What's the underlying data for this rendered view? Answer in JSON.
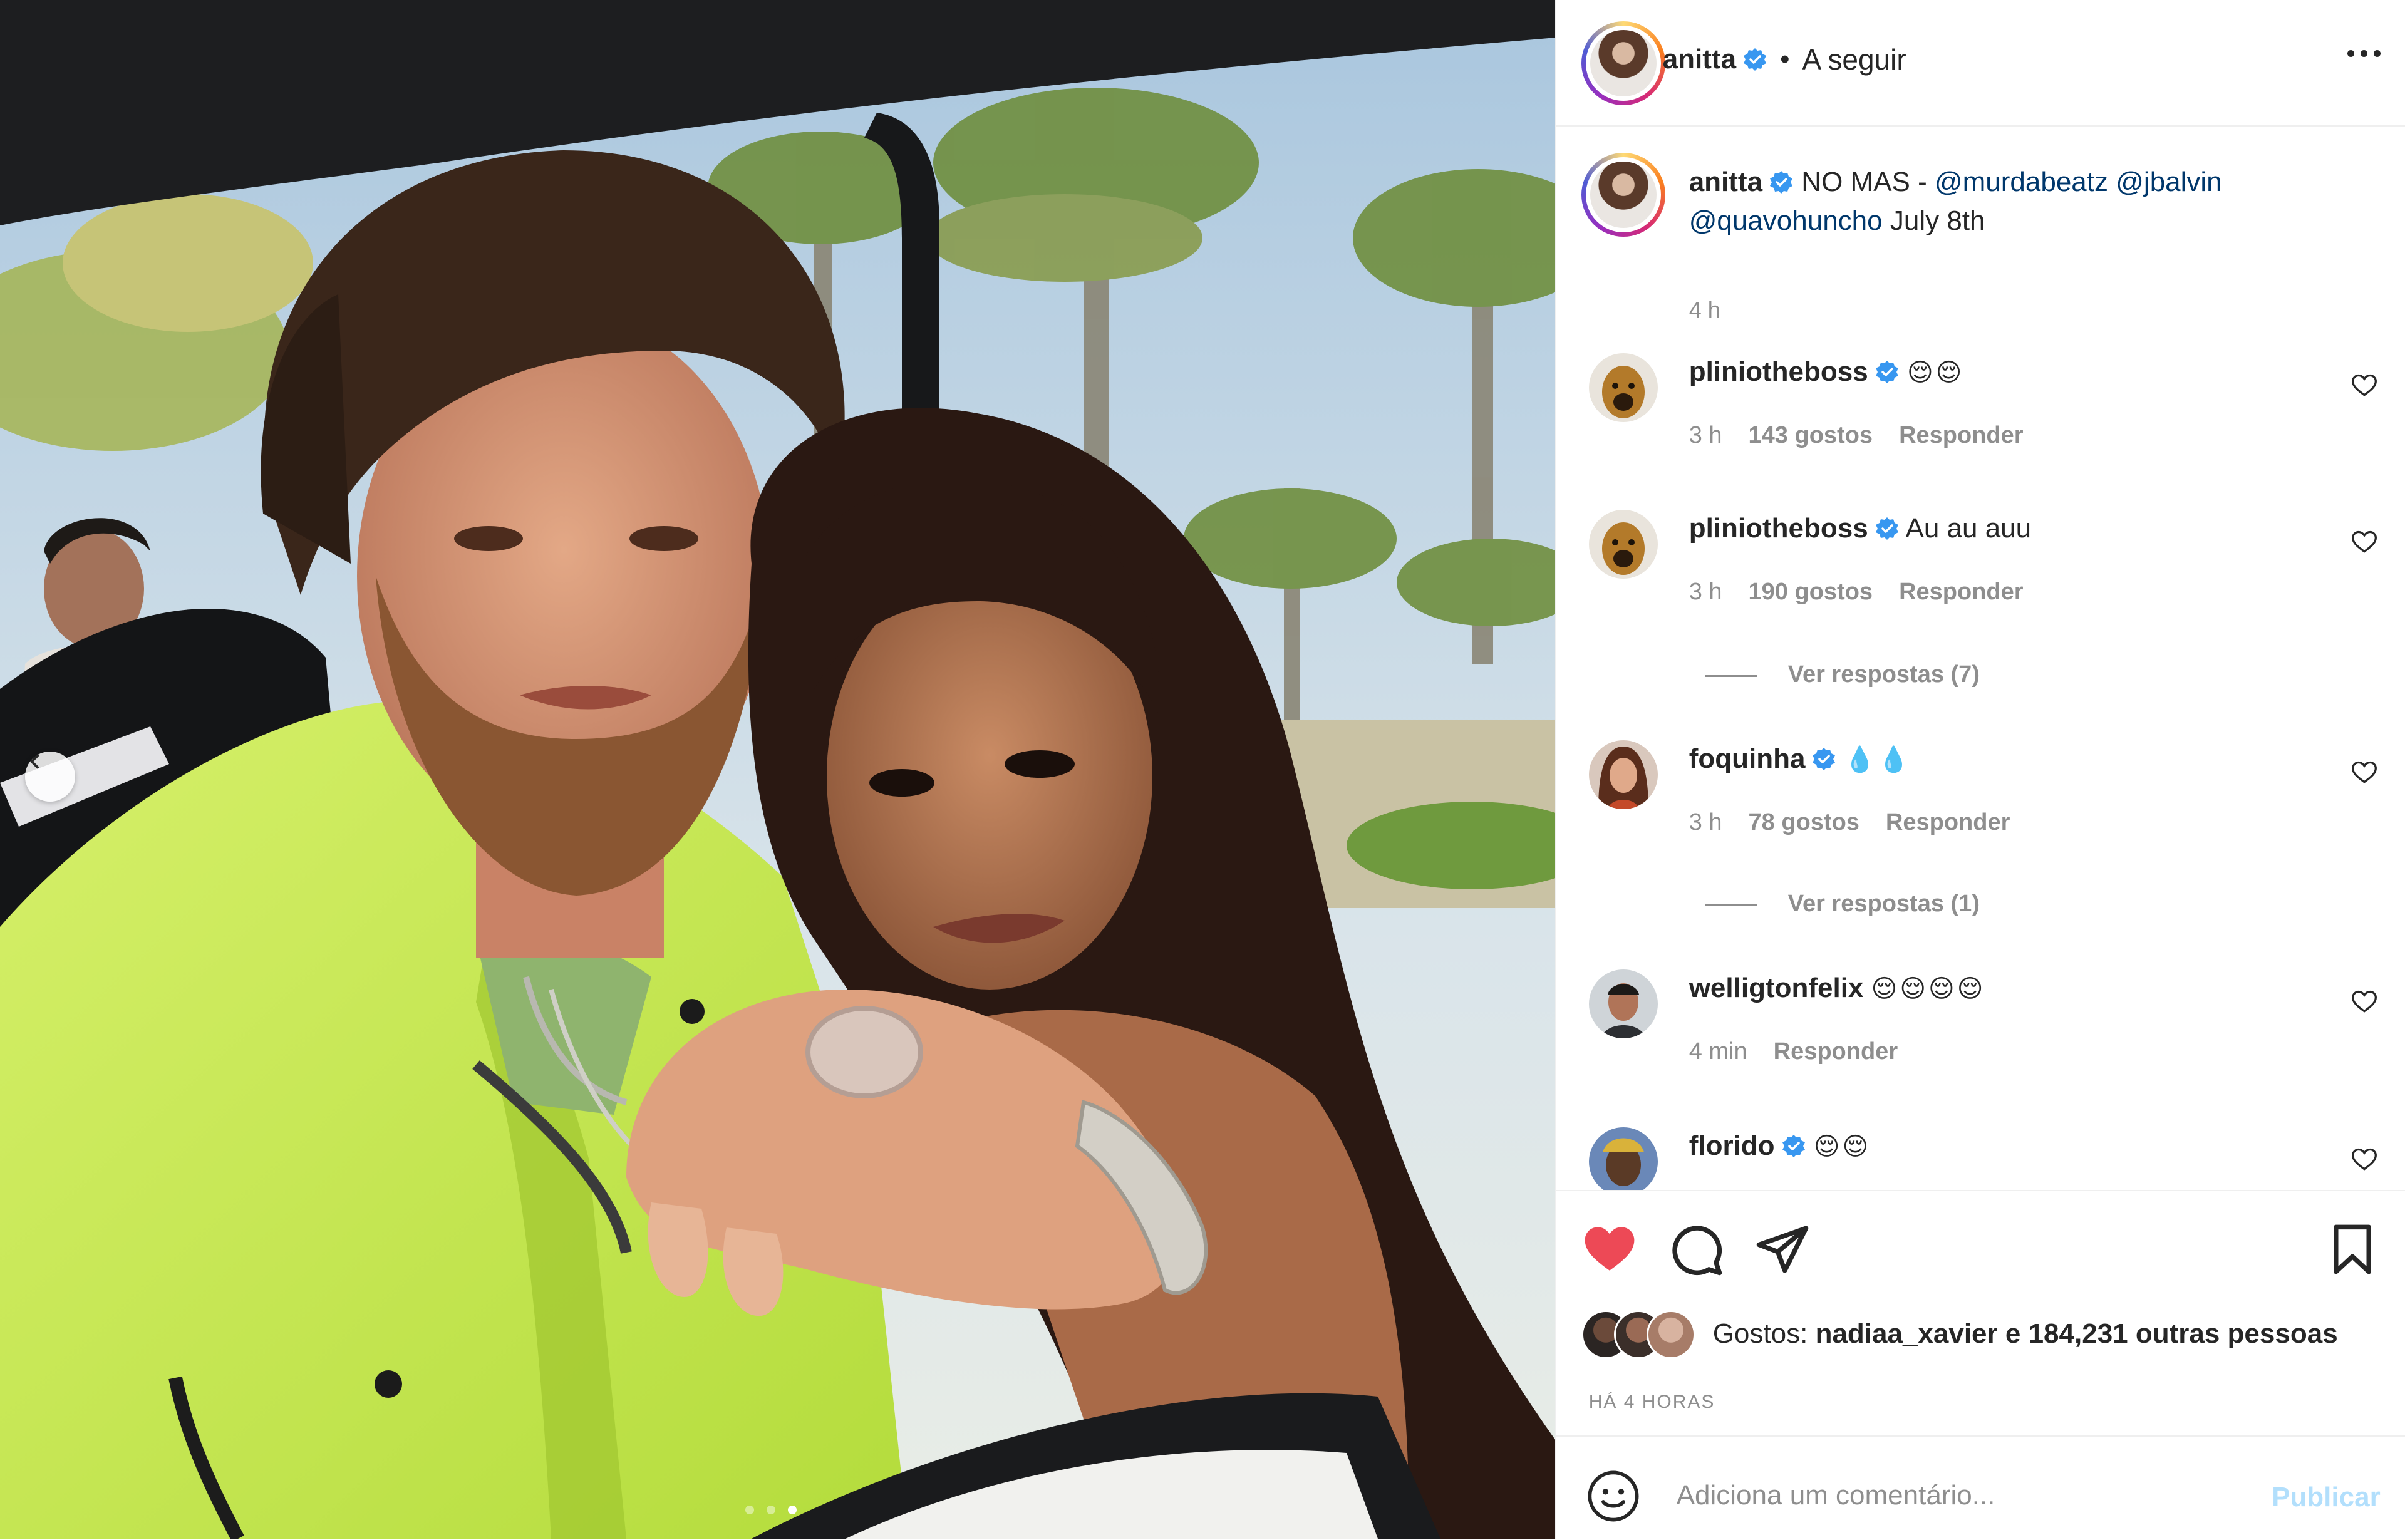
{
  "header": {
    "username": "anitta",
    "separator": "•",
    "follow_label": "A seguir",
    "more_icon": "more-horizontal-icon"
  },
  "caption": {
    "username": "anitta",
    "text_before": "NO MAS - ",
    "mention_1": "@murdabeatz",
    "mention_2": "@jbalvin",
    "mention_3": "@quavohuncho",
    "text_after": "July 8th",
    "time": "4 h"
  },
  "comments": [
    {
      "username": "pliniotheboss",
      "verified": true,
      "text": "😌😌",
      "time": "3 h",
      "likes": "143 gostos",
      "reply": "Responder"
    },
    {
      "username": "pliniotheboss",
      "verified": true,
      "text": "Au au auu",
      "time": "3 h",
      "likes": "190 gostos",
      "reply": "Responder",
      "view_replies": "Ver respostas (7)"
    },
    {
      "username": "foquinha",
      "verified": true,
      "text": "💧💧",
      "time": "3 h",
      "likes": "78 gostos",
      "reply": "Responder",
      "view_replies": "Ver respostas (1)"
    },
    {
      "username": "welligtonfelix",
      "verified": false,
      "text": "😌😌😌😌",
      "time": "4 min",
      "reply": "Responder"
    },
    {
      "username": "florido",
      "verified": true,
      "text": "😌😌"
    }
  ],
  "actions": {
    "likes_prefix": "Gostos:",
    "likes_user": "nadiaa_xavier",
    "likes_suffix": "e 184,231 outras pessoas",
    "posted": "HÁ 4 HORAS",
    "liked": true,
    "like_color": "#ed4956"
  },
  "add_comment": {
    "placeholder": "Adiciona um comentário...",
    "publish_label": "Publicar"
  },
  "media": {
    "slide_count": 3,
    "active_slide": 3
  }
}
